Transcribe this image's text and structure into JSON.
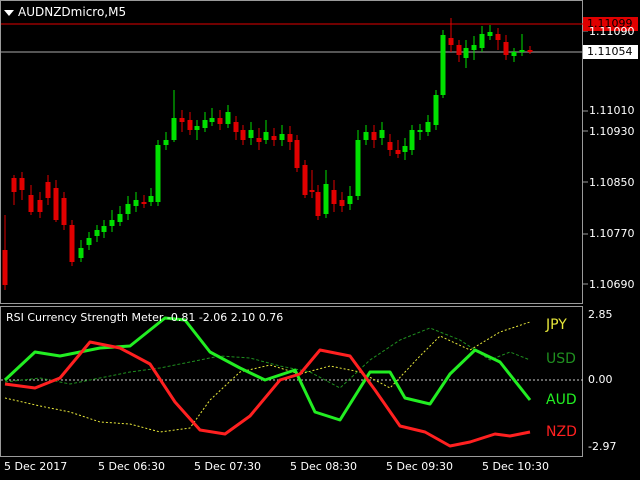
{
  "window": {
    "title": "AUDNZDmicro,M5"
  },
  "price_axis": {
    "labels": [
      "1.11090",
      "1.11010",
      "1.10930",
      "1.10850",
      "1.10770",
      "1.10690"
    ],
    "red_box": "1.11099",
    "white_box": "1.11054"
  },
  "indicator": {
    "title": "RSI Currency Strength Meter -0.81 -2.06 2.10 0.76",
    "levels": [
      "2.85",
      "0.00",
      "-2.97"
    ],
    "currencies": [
      {
        "name": "JPY",
        "color": "#e8e83a"
      },
      {
        "name": "USD",
        "color": "#1f8f1f"
      },
      {
        "name": "AUD",
        "color": "#22ee22"
      },
      {
        "name": "NZD",
        "color": "#ff2020"
      }
    ]
  },
  "time_axis": {
    "labels": [
      "5 Dec 2017",
      "5 Dec 06:30",
      "5 Dec 07:30",
      "5 Dec 08:30",
      "5 Dec 09:30",
      "5 Dec 10:30"
    ]
  },
  "colors": {
    "bull": "#00e000",
    "bear": "#e00000",
    "grid": "#808080"
  }
}
